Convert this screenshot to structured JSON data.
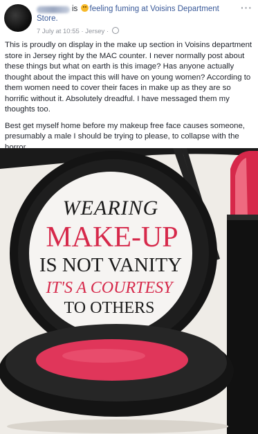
{
  "post": {
    "status_text": "is",
    "feeling_text": "feeling fuming at Voisins Department",
    "store_suffix": "Store.",
    "date": "7 July at 10:55",
    "location": "Jersey",
    "more_icon": "···",
    "paragraph_1": "This is proudly on display in the make up section in Voisins department store in Jersey right by the MAC counter. I never normally post about these things but what on earth is this image? Has anyone actually thought about the impact this will have on young women? According to them women need to cover their faces in make up as they are so horrific without it. Absolutely dreadful. I have messaged them my thoughts too.",
    "paragraph_2": "Best get myself home before my makeup free face causes someone, presumably a male I should be trying to please, to collapse with the horror."
  },
  "image": {
    "line1": "WEARING",
    "line2": "MAKE-UP",
    "line3": "IS NOT VANITY",
    "line4": "IT'S A COURTESY",
    "line5": "TO OTHERS"
  },
  "colors": {
    "link": "#385898",
    "meta": "#90949c",
    "pink": "#e0365a",
    "compact_black": "#141414"
  }
}
